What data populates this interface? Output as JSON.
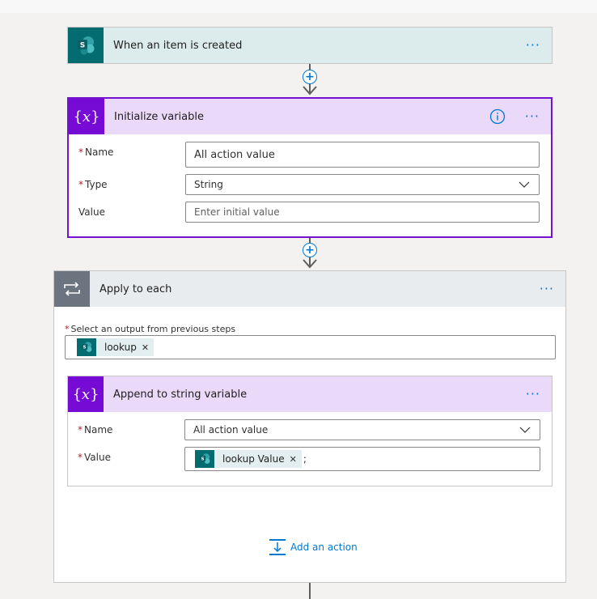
{
  "trigger": {
    "title": "When an item is created",
    "icon": "sharepoint-icon"
  },
  "init_var": {
    "title": "Initialize variable",
    "icon": "variable-icon",
    "fields": {
      "name_label": "Name",
      "name_value": "All action value",
      "type_label": "Type",
      "type_value": "String",
      "value_label": "Value",
      "value_placeholder": "Enter initial value"
    }
  },
  "apply_each": {
    "title": "Apply to each",
    "icon": "loop-icon",
    "select_label": "Select an output from previous steps",
    "token": "lookup"
  },
  "append": {
    "title": "Append to string variable",
    "icon": "variable-icon",
    "name_label": "Name",
    "name_value": "All action value",
    "value_label": "Value",
    "value_token": "lookup Value",
    "value_suffix": ";"
  },
  "add_action": {
    "label": "Add an action"
  },
  "menu_glyph": "···",
  "required_marker": "*",
  "colors": {
    "sharepoint": "#036c70",
    "variable": "#770bd6",
    "variable_header": "#ead9f9",
    "trigger_header": "#dcebec",
    "loop_icon_bg": "#6c7480",
    "loop_header": "#e9ecef",
    "link": "#0078d4"
  }
}
